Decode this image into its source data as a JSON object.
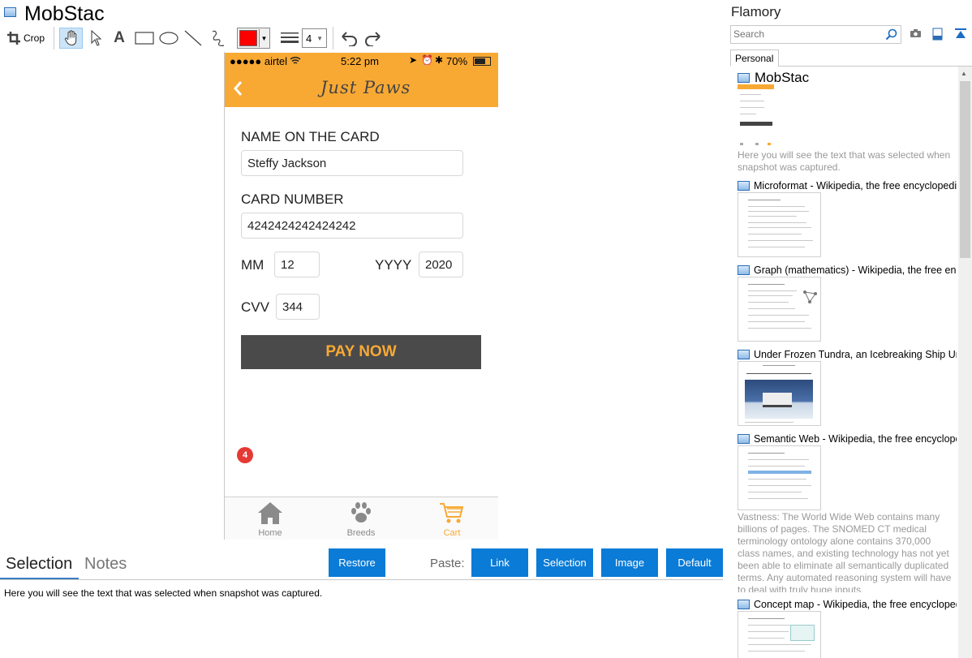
{
  "app": {
    "title": "MobStac"
  },
  "toolbar": {
    "crop_label": "Crop",
    "tools": [
      "hand-tool",
      "select-arrow",
      "text-tool",
      "rectangle-tool",
      "ellipse-tool",
      "line-tool",
      "freehand-tool"
    ],
    "text_tool_glyph": "A",
    "color": "#ff0000",
    "line_width": "4"
  },
  "phone": {
    "status": {
      "carrier": "●●●●● airtel",
      "time": "5:22 pm",
      "battery": "70%"
    },
    "brand": "Just Paws",
    "form": {
      "name_label": "NAME ON THE CARD",
      "name_value": "Steffy Jackson",
      "card_label": "CARD NUMBER",
      "card_value": "4242424242424242",
      "mm_label": "MM",
      "mm_value": "12",
      "yyyy_label": "YYYY",
      "yyyy_value": "2020",
      "cvv_label": "CVV",
      "cvv_value": "344",
      "pay_label": "PAY NOW"
    },
    "tabs": [
      {
        "label": "Home"
      },
      {
        "label": "Breeds"
      },
      {
        "label": "Cart",
        "badge": "4"
      }
    ],
    "accent": "#f8a934"
  },
  "bottom": {
    "tabs": [
      "Selection",
      "Notes"
    ],
    "restore_label": "Restore",
    "paste_label": "Paste:",
    "paste_buttons": [
      "Link",
      "Selection",
      "Image",
      "Default"
    ],
    "selection_text": "Here you will see the text that was selected when snapshot was captured.",
    "button_color": "#0a7bd6"
  },
  "sidebar": {
    "title": "Flamory",
    "search_placeholder": "Search",
    "tab": "Personal",
    "items": [
      {
        "title": "MobStac",
        "note": "Here you will see the text that was selected when snapshot was captured."
      },
      {
        "title": "Microformat - Wikipedia, the free encyclopedia"
      },
      {
        "title": "Graph (mathematics) - Wikipedia, the free ency"
      },
      {
        "title": "Under Frozen Tundra, an Icebreaking Ship Unco"
      },
      {
        "title": "Semantic Web - Wikipedia, the free encycloped",
        "note": "Vastness: The World Wide Web contains many billions of pages. The SNOMED CT medical terminology ontology alone contains 370,000 class names, and existing technology has not yet been able to eliminate all semantically duplicated terms. Any automated reasoning system will have to deal with truly huge inputs."
      },
      {
        "title": "Concept map - Wikipedia, the free encyclopedi"
      }
    ]
  }
}
